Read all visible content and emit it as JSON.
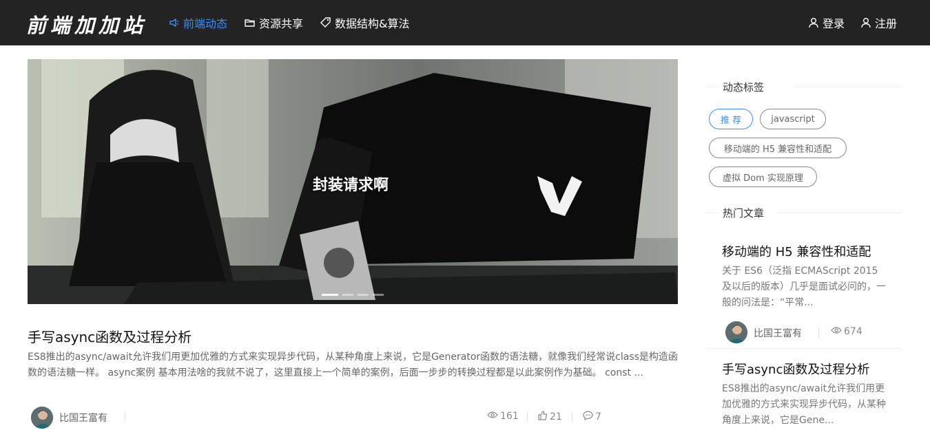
{
  "header": {
    "logo": "前端加加站",
    "nav": [
      {
        "label": "前端动态",
        "icon": "announcement-icon",
        "active": true
      },
      {
        "label": "资源共享",
        "icon": "folder-icon",
        "active": false
      },
      {
        "label": "数据结构&算法",
        "icon": "tag-icon",
        "active": false
      }
    ],
    "login_label": "登录",
    "register_label": "注册"
  },
  "carousel": {
    "caption": "封装请求啊",
    "slide_count": 4,
    "active_index": 0
  },
  "article": {
    "title": "手写async函数及过程分析",
    "summary": "ES8推出的async/await允许我们用更加优雅的方式来实现异步代码，从某种角度上来说，它是Generator函数的语法糖，就像我们经常说class是构造函数的语法糖一样。 async案例 基本用法啥的我就不说了，这里直接上一个简单的案例，后面一步步的转换过程都是以此案例作为基础。 const ...",
    "author": "比国王富有",
    "views": "161",
    "likes": "21",
    "comments": "7"
  },
  "sidebar": {
    "tags_heading": "动态标签",
    "tags": [
      "推 荐",
      "javascript",
      "移动端的 H5 兼容性和适配",
      "虚拟 Dom 实现原理"
    ],
    "hot_heading": "热门文章",
    "hot_articles": [
      {
        "title": "移动端的 H5 兼容性和适配",
        "summary": "关于 ES6（泛指 ECMAScript 2015 及以后的版本）几乎是面试必问的，一般的问法是：“平常...",
        "author": "比国王富有",
        "views": "674"
      },
      {
        "title": "手写async函数及过程分析",
        "summary": "ES8推出的async/await允许我们用更加优雅的方式来实现异步代码，从某种角度上来说，它是Gene..."
      }
    ]
  },
  "colors": {
    "header_bg": "#232323",
    "accent": "#3d8ef8"
  }
}
